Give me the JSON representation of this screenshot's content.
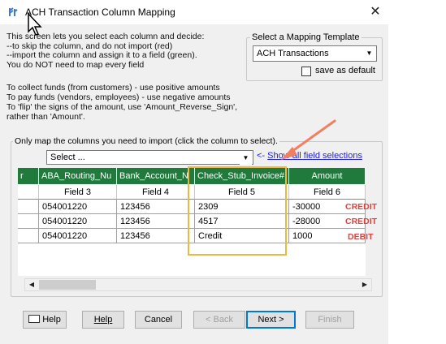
{
  "window": {
    "title": "ACH Transaction Column Mapping",
    "close_glyph": "✕"
  },
  "intro": {
    "text1": "This screen lets you select each column and decide:\n--to skip the column, and do not import (red)\n--import the column and assign it to a field (green).\nYou do NOT need to map every field",
    "text2": "To collect funds (from customers) - use positive amounts\nTo pay funds (vendors, employees) - use negative amounts\nTo 'flip' the signs of the amount, use 'Amount_Reverse_Sign',\nrather than 'Amount'."
  },
  "template": {
    "legend": "Select a Mapping Template",
    "selected": "ACH Transactions",
    "save_default_label": "save as default",
    "save_default_checked": false
  },
  "mapping": {
    "legend": "Only map the columns you need to import (click the column to select).",
    "select_value": "Select ...",
    "show_all_prefix": "<- ",
    "show_all_link": "Show all field selections",
    "columns": [
      {
        "header": "r",
        "field": ""
      },
      {
        "header": "ABA_Routing_Nu",
        "field": "Field 3"
      },
      {
        "header": "Bank_Account_N",
        "field": "Field 4"
      },
      {
        "header": "Check_Stub_Invoice#",
        "field": "Field 5"
      },
      {
        "header": "Amount",
        "field": "Field 6"
      }
    ],
    "rows": [
      {
        "routing": "054001220",
        "account": "123456",
        "stub": "2309",
        "amount": "-30000",
        "label": "CREDIT"
      },
      {
        "routing": "054001220",
        "account": "123456",
        "stub": "4517",
        "amount": "-28000",
        "label": "CREDIT"
      },
      {
        "routing": "054001220",
        "account": "123456",
        "stub": "Credit",
        "amount": "1000",
        "label": "DEBIT"
      }
    ]
  },
  "buttons": {
    "help_icon_label": "Help",
    "help": "Help",
    "cancel": "Cancel",
    "back": "< Back",
    "next": "Next >",
    "finish": "Finish"
  },
  "colors": {
    "header_green": "#1f7a3c",
    "annotation_red": "#e0433f",
    "highlight_box": "#f0b73c",
    "arrow": "#f08060",
    "link": "#1a1aff"
  }
}
